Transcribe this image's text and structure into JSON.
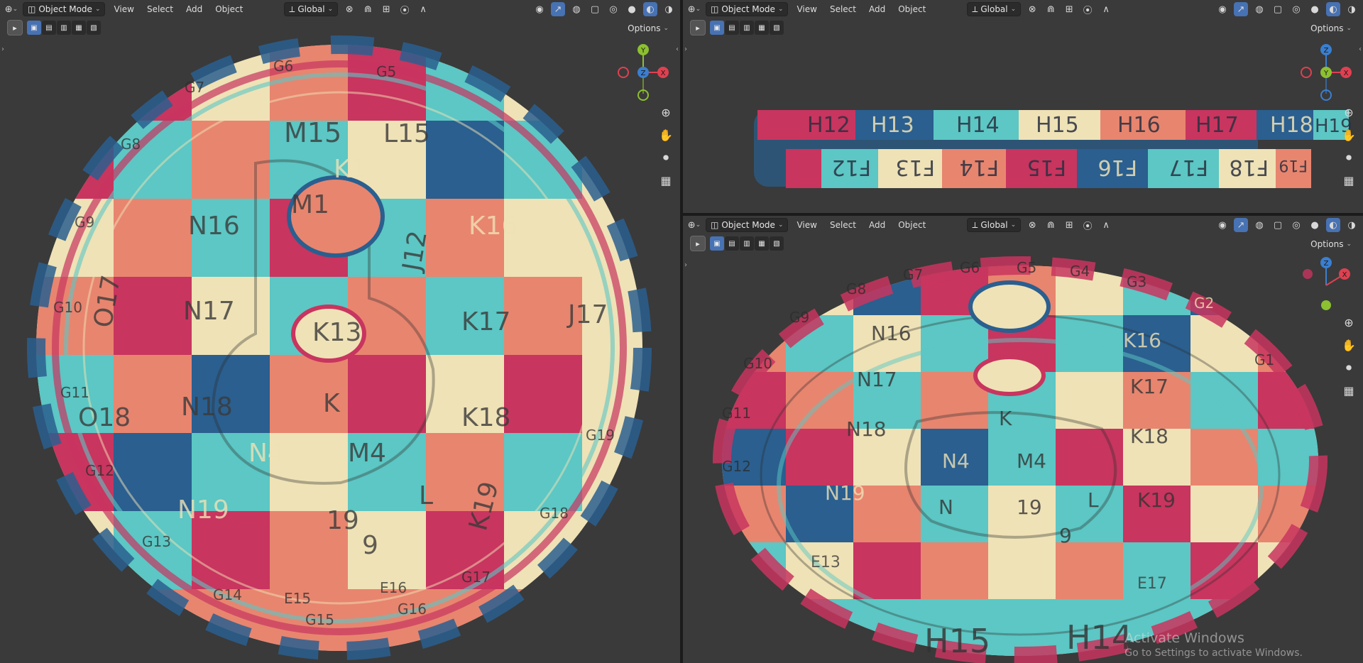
{
  "header": {
    "mode": "Object Mode",
    "menus": [
      "View",
      "Select",
      "Add",
      "Object"
    ],
    "orientation": "Global",
    "options": "Options"
  },
  "gizmo_axes": {
    "x": "X",
    "y": "Y",
    "z": "Z"
  },
  "colors": {
    "viewport_bg": "#3a3a3a",
    "accent": "#4772b3",
    "axis_x": "#e04050",
    "axis_y": "#8cc030",
    "axis_z": "#3a7fd0",
    "tile_pink": "#c8355f",
    "tile_salmon": "#e8856f",
    "tile_cream": "#efe2b6",
    "tile_teal": "#5cc7c4",
    "tile_blue": "#2a5f8f"
  },
  "icons": [
    "editor-type-icon",
    "object-mode-icon",
    "transform-orientation-icon",
    "pivot-icon",
    "snap-icon",
    "proportional-edit-icon",
    "visibility-icon",
    "gizmo-icon",
    "overlay-icon",
    "xray-icon",
    "wireframe-shading-icon",
    "solid-shading-icon",
    "material-shading-icon",
    "rendered-shading-icon",
    "zoom-icon",
    "pan-hand-icon",
    "camera-icon",
    "grid-icon"
  ],
  "left_view": {
    "labels": [
      "M15",
      "L15",
      "K1",
      "M1",
      "N16",
      "K16",
      "J12",
      "N17",
      "K17",
      "J17",
      "O17",
      "K13",
      "K",
      "N18",
      "K18",
      "O18",
      "N4",
      "M4",
      "N19",
      "K19",
      "L",
      "19",
      "9",
      "G5",
      "G6",
      "G7",
      "G8",
      "G9",
      "G10",
      "G11",
      "G12",
      "G13",
      "G14",
      "G15",
      "G16",
      "G17",
      "G18",
      "G19",
      "E15",
      "E16"
    ]
  },
  "top_right_view": {
    "upper_labels": [
      "H12",
      "H13",
      "H14",
      "H15",
      "H16",
      "H17",
      "H18",
      "H19"
    ],
    "lower_labels": [
      "F12",
      "F13",
      "F14",
      "F15",
      "F16",
      "F17",
      "F18",
      "F19"
    ]
  },
  "bottom_right_view": {
    "labels": [
      "G7",
      "G6",
      "G5",
      "G4",
      "G3",
      "G2",
      "G8",
      "G9",
      "G10",
      "G11",
      "G12",
      "G1",
      "N16",
      "K16",
      "N17",
      "K17",
      "N18",
      "K18",
      "N19",
      "K19",
      "N4",
      "M4",
      "N",
      "19",
      "L",
      "9",
      "K",
      "H15",
      "H14",
      "E17",
      "E13"
    ],
    "bottom_rim": [
      "H15",
      "H14"
    ]
  },
  "watermark": {
    "title": "Activate Windows",
    "subtitle": "Go to Settings to activate Windows."
  }
}
